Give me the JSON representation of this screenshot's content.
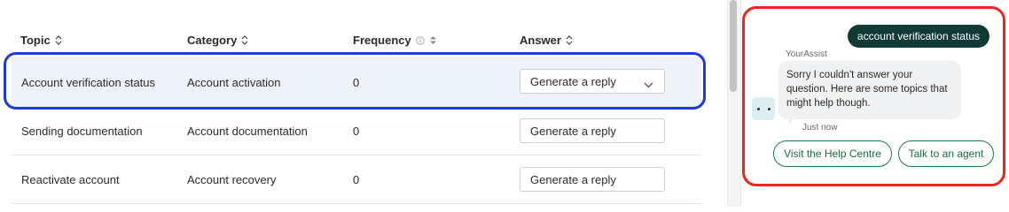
{
  "table": {
    "headers": {
      "topic": "Topic",
      "category": "Category",
      "frequency": "Frequency",
      "answer": "Answer"
    },
    "rows": [
      {
        "topic": "Account verification status",
        "category": "Account activation",
        "frequency": "0",
        "answer": "Generate a reply",
        "selected": true
      },
      {
        "topic": "Sending documentation",
        "category": "Account documentation",
        "frequency": "0",
        "answer": "Generate a reply",
        "selected": false
      },
      {
        "topic": "Reactivate account",
        "category": "Account recovery",
        "frequency": "0",
        "answer": "Generate a reply",
        "selected": false
      }
    ]
  },
  "chat": {
    "user_message": "account verification status",
    "bot_name": "YourAssist",
    "bot_message": "Sorry I couldn't answer your question. Here are some topics that might help though.",
    "timestamp": "Just now",
    "actions": {
      "help_centre": "Visit the Help Centre",
      "agent": "Talk to an agent"
    }
  },
  "colors": {
    "highlight_row": "#edf3f9",
    "highlight_outline": "#1f3bd6",
    "chat_outline": "#e8281c",
    "user_bubble": "#0f3b34",
    "chip_text": "#1a6b3f"
  },
  "icons": {
    "sort": "sort-updown-icon",
    "info": "info-icon",
    "dropdown": "chevron-down-icon",
    "bot": "bot-avatar-icon"
  }
}
